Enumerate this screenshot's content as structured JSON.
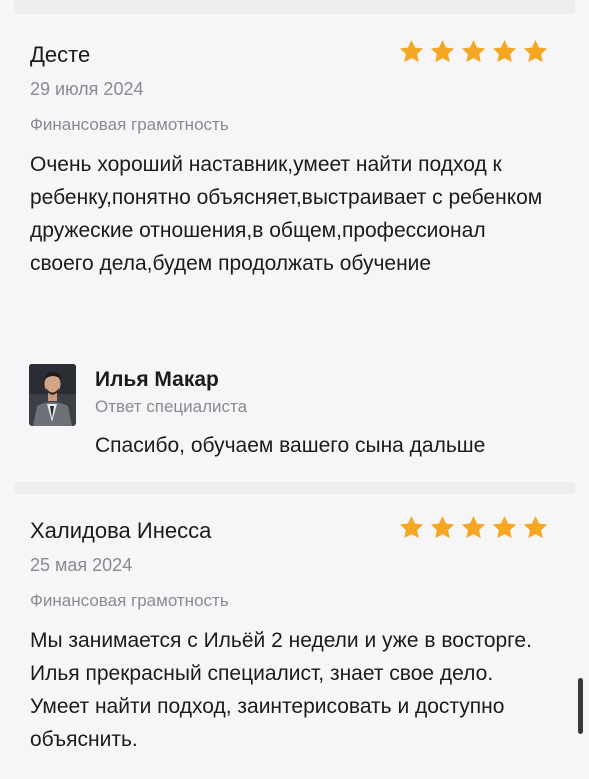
{
  "reviews": [
    {
      "author": "Десте",
      "date": "29 июля 2024",
      "subject": "Финансовая грамотность",
      "rating": 5,
      "text": "Очень хороший наставник,умеет найти подход к ребенку,понятно объясняет,выстраивает с ребенком дружеские отношения,в общем,профессионал своего дела,будем продолжать обучение",
      "reply": {
        "name": "Илья Макар",
        "role": "Ответ специалиста",
        "text": "Спасибо, обучаем вашего сына дальше"
      }
    },
    {
      "author": "Халидова Инесса",
      "date": "25 мая 2024",
      "subject": "Финансовая грамотность",
      "rating": 5,
      "text": "Мы занимается с Ильёй 2 недели и уже в восторге. Илья прекрасный специалист, знает свое дело. Умеет найти подход, заинтерисовать и доступно объяснить."
    }
  ],
  "colors": {
    "star": "#f5a623",
    "muted_text": "#8a8a8f",
    "background": "#f6f6f8"
  },
  "icons": {
    "star": "star-icon",
    "avatar": "specialist-photo"
  }
}
